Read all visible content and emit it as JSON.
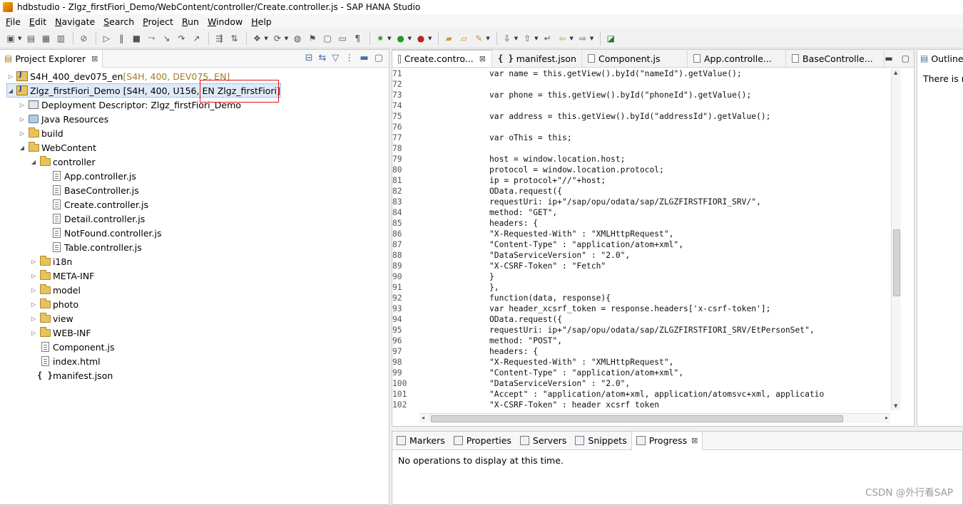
{
  "window": {
    "title": "hdbstudio - Zlgz_firstFiori_Demo/WebContent/controller/Create.controller.js - SAP HANA Studio"
  },
  "menu": [
    "File",
    "Edit",
    "Navigate",
    "Search",
    "Project",
    "Run",
    "Window",
    "Help"
  ],
  "project_explorer": {
    "tab_label": "Project Explorer",
    "tree": [
      {
        "label": "S4H_400_dev075_en",
        "decoration": " [S4H, 400, DEV075, EN]",
        "depth": 0,
        "arrow": "▷",
        "icon": "project-icon"
      },
      {
        "label": "Zlgz_firstFiori_Demo [S4H, 400, U156, EN",
        "decoration": "Zlgz_firstFiori]",
        "depth": 0,
        "arrow": "◢",
        "icon": "project-icon",
        "selected": true
      },
      {
        "label": "Deployment Descriptor: Zlgz_firstFiori_Demo",
        "decoration": "",
        "depth": 1,
        "arrow": "▷",
        "icon": "descriptor-icon"
      },
      {
        "label": "Java Resources",
        "decoration": "",
        "depth": 1,
        "arrow": "▷",
        "icon": "java-resources-icon"
      },
      {
        "label": "build",
        "decoration": "",
        "depth": 1,
        "arrow": "▷",
        "icon": "folder-icon"
      },
      {
        "label": "WebContent",
        "decoration": "",
        "depth": 1,
        "arrow": "◢",
        "icon": "folder-icon"
      },
      {
        "label": "controller",
        "decoration": "",
        "depth": 2,
        "arrow": "◢",
        "icon": "folder-icon"
      },
      {
        "label": "App.controller.js",
        "decoration": "",
        "depth": 3,
        "arrow": "",
        "icon": "js-file-icon"
      },
      {
        "label": "BaseController.js",
        "decoration": "",
        "depth": 3,
        "arrow": "",
        "icon": "js-file-icon"
      },
      {
        "label": "Create.controller.js",
        "decoration": "",
        "depth": 3,
        "arrow": "",
        "icon": "js-file-icon"
      },
      {
        "label": "Detail.controller.js",
        "decoration": "",
        "depth": 3,
        "arrow": "",
        "icon": "js-file-icon"
      },
      {
        "label": "NotFound.controller.js",
        "decoration": "",
        "depth": 3,
        "arrow": "",
        "icon": "js-file-icon"
      },
      {
        "label": "Table.controller.js",
        "decoration": "",
        "depth": 3,
        "arrow": "",
        "icon": "js-file-icon"
      },
      {
        "label": "i18n",
        "decoration": "",
        "depth": 2,
        "arrow": "▷",
        "icon": "folder-icon"
      },
      {
        "label": "META-INF",
        "decoration": "",
        "depth": 2,
        "arrow": "▷",
        "icon": "folder-icon"
      },
      {
        "label": "model",
        "decoration": "",
        "depth": 2,
        "arrow": "▷",
        "icon": "folder-icon"
      },
      {
        "label": "photo",
        "decoration": "",
        "depth": 2,
        "arrow": "▷",
        "icon": "folder-icon"
      },
      {
        "label": "view",
        "decoration": "",
        "depth": 2,
        "arrow": "▷",
        "icon": "folder-icon"
      },
      {
        "label": "WEB-INF",
        "decoration": "",
        "depth": 2,
        "arrow": "▷",
        "icon": "folder-icon"
      },
      {
        "label": "Component.js",
        "decoration": "",
        "depth": 2,
        "arrow": "",
        "icon": "js-file-icon"
      },
      {
        "label": "index.html",
        "decoration": "",
        "depth": 2,
        "arrow": "",
        "icon": "html-file-icon"
      },
      {
        "label": "manifest.json",
        "decoration": "",
        "depth": 2,
        "arrow": "",
        "icon": "json-file-icon"
      }
    ]
  },
  "editor": {
    "tabs": [
      {
        "label": "Create.contro...",
        "icon": "js-file-icon",
        "active": true,
        "close": "⊠"
      },
      {
        "label": "manifest.json",
        "icon": "json-file-icon",
        "active": false,
        "close": ""
      },
      {
        "label": "Component.js",
        "icon": "js-file-icon",
        "active": false,
        "close": ""
      },
      {
        "label": "App.controlle...",
        "icon": "js-file-icon",
        "active": false,
        "close": ""
      },
      {
        "label": "BaseControlle...",
        "icon": "js-file-icon",
        "active": false,
        "close": ""
      }
    ],
    "lines": [
      {
        "n": "71",
        "t": "var name = this.getView().byId(\"nameId\").getValue();"
      },
      {
        "n": "72",
        "t": ""
      },
      {
        "n": "73",
        "t": "var phone = this.getView().byId(\"phoneId\").getValue();"
      },
      {
        "n": "74",
        "t": ""
      },
      {
        "n": "75",
        "t": "var address = this.getView().byId(\"addressId\").getValue();"
      },
      {
        "n": "76",
        "t": ""
      },
      {
        "n": "77",
        "t": "var oThis = this;"
      },
      {
        "n": "78",
        "t": ""
      },
      {
        "n": "79",
        "t": "host = window.location.host;"
      },
      {
        "n": "80",
        "t": "protocol = window.location.protocol;"
      },
      {
        "n": "81",
        "t": "ip = protocol+\"//\"+host;"
      },
      {
        "n": "82",
        "t": "OData.request({"
      },
      {
        "n": "83",
        "t": "    requestUri: ip+\"/sap/opu/odata/sap/ZLGZFIRSTFIORI_SRV/\","
      },
      {
        "n": "84",
        "t": "    method: \"GET\","
      },
      {
        "n": "85",
        "t": "    headers: {"
      },
      {
        "n": "86",
        "t": "        \"X-Requested-With\" : \"XMLHttpRequest\","
      },
      {
        "n": "87",
        "t": "        \"Content-Type\" : \"application/atom+xml\","
      },
      {
        "n": "88",
        "t": "        \"DataServiceVersion\" : \"2.0\","
      },
      {
        "n": "89",
        "t": "        \"X-CSRF-Token\" : \"Fetch\""
      },
      {
        "n": "90",
        "t": "    }"
      },
      {
        "n": "91",
        "t": "},"
      },
      {
        "n": "92",
        "t": "function(data, response){"
      },
      {
        "n": "93",
        "t": "    var header_xcsrf_token = response.headers['x-csrf-token'];"
      },
      {
        "n": "94",
        "t": "    OData.request({"
      },
      {
        "n": "95",
        "t": "        requestUri: ip+\"/sap/opu/odata/sap/ZLGZFIRSTFIORI_SRV/EtPersonSet\","
      },
      {
        "n": "96",
        "t": "        method: \"POST\","
      },
      {
        "n": "97",
        "t": "        headers: {"
      },
      {
        "n": "98",
        "t": "            \"X-Requested-With\" : \"XMLHttpRequest\","
      },
      {
        "n": "99",
        "t": "            \"Content-Type\" : \"application/atom+xml\","
      },
      {
        "n": "100",
        "t": "            \"DataServiceVersion\" : \"2.0\","
      },
      {
        "n": "101",
        "t": "            \"Accept\" : \"application/atom+xml, application/atomsvc+xml, applicatio"
      },
      {
        "n": "102",
        "t": "            \"X-CSRF-Token\" : header_xcsrf_token"
      }
    ]
  },
  "outline": {
    "tab_label": "Outline",
    "message": "There is n"
  },
  "bottom_panel": {
    "tabs": [
      {
        "label": "Markers",
        "icon": "markers-icon",
        "active": false
      },
      {
        "label": "Properties",
        "icon": "properties-icon",
        "active": false
      },
      {
        "label": "Servers",
        "icon": "servers-icon",
        "active": false
      },
      {
        "label": "Snippets",
        "icon": "snippets-icon",
        "active": false
      },
      {
        "label": "Progress",
        "icon": "progress-icon",
        "active": true
      }
    ],
    "message": "No operations to display at this time."
  },
  "watermark": "CSDN @外行看SAP",
  "colors": {
    "highlight_box": "#e0161e",
    "folder": "#e8c25c",
    "selection": "#dfeaf7"
  }
}
